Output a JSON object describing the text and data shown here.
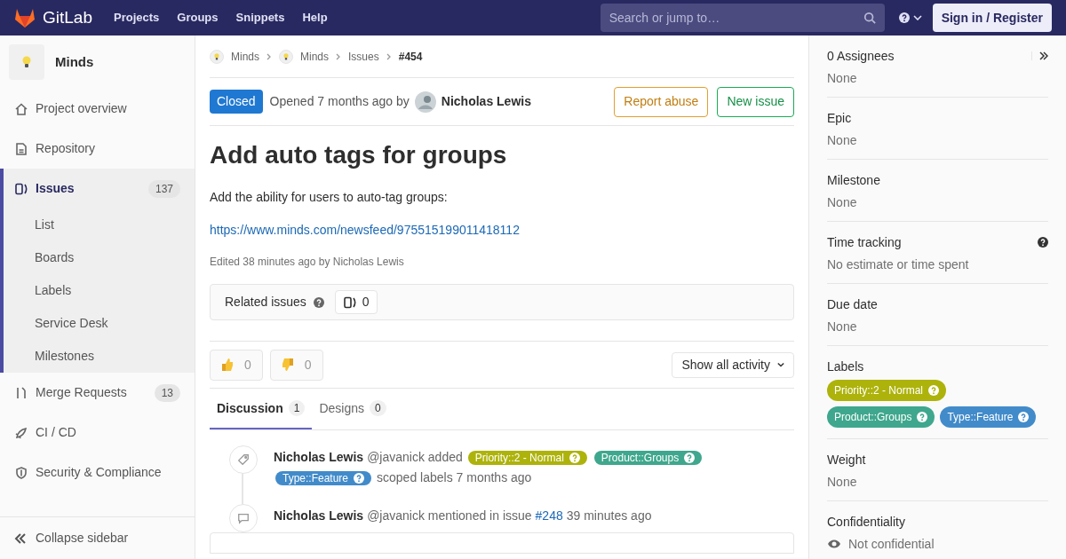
{
  "header": {
    "brand": "GitLab",
    "nav": [
      "Projects",
      "Groups",
      "Snippets",
      "Help"
    ],
    "search": {
      "placeholder": "Search or jump to…"
    },
    "sign_in": "Sign in / Register"
  },
  "sidebar": {
    "project": "Minds",
    "items": [
      {
        "label": "Project overview",
        "selected": false
      },
      {
        "label": "Repository",
        "selected": false
      },
      {
        "label": "Issues",
        "badge": "137",
        "selected": true,
        "children": [
          {
            "label": "List"
          },
          {
            "label": "Boards"
          },
          {
            "label": "Labels"
          },
          {
            "label": "Service Desk"
          },
          {
            "label": "Milestones"
          }
        ]
      },
      {
        "label": "Merge Requests",
        "badge": "13",
        "selected": false
      },
      {
        "label": "CI / CD",
        "selected": false
      },
      {
        "label": "Security & Compliance",
        "selected": false
      }
    ],
    "collapse": "Collapse sidebar"
  },
  "breadcrumbs": [
    "Minds",
    "Minds",
    "Issues",
    "#454"
  ],
  "issue": {
    "status": "Closed",
    "opened": "Opened 7 months ago by",
    "author": "Nicholas Lewis",
    "actions": [
      "Report abuse",
      "New issue"
    ],
    "title": "Add auto tags for groups",
    "description": "Add the ability for users to auto-tag groups:",
    "link": "https://www.minds.com/newsfeed/975515199011418112",
    "edited": "Edited 38 minutes ago by Nicholas Lewis",
    "related": {
      "label": "Related issues",
      "count": "0"
    },
    "reactions": [
      {
        "kind": "up",
        "count": "0"
      },
      {
        "kind": "down",
        "count": "0"
      }
    ],
    "activity_filter": "Show all activity",
    "tabs": [
      {
        "label": "Discussion",
        "count": "1",
        "selected": true
      },
      {
        "label": "Designs",
        "count": "0",
        "selected": false
      }
    ],
    "notes": [
      {
        "kind": "labels",
        "author": "Nicholas Lewis",
        "handle": "@javanick added",
        "labels": [
          {
            "text": "Priority::2 - Normal",
            "color": "#adb30b"
          },
          {
            "text": "Product::Groups",
            "color": "#3fa78d"
          },
          {
            "text": "Type::Feature",
            "color": "#428bca"
          }
        ],
        "tail": "scoped labels 7 months ago"
      },
      {
        "kind": "mention",
        "author": "Nicholas Lewis",
        "handle": "@javanick mentioned in issue",
        "ref": "#248",
        "tail": "39 minutes ago"
      }
    ]
  },
  "right_sidebar": {
    "sections": [
      {
        "title": "0 Assignees",
        "value": "None"
      },
      {
        "title": "Epic",
        "value": "None"
      },
      {
        "title": "Milestone",
        "value": "None"
      },
      {
        "kind": "help",
        "title": "Time tracking",
        "value": "No estimate or time spent"
      },
      {
        "title": "Due date",
        "value": "None"
      },
      {
        "title": "Labels",
        "labels": [
          {
            "text": "Priority::2 - Normal",
            "color": "#adb30b"
          },
          {
            "text": "Product::Groups",
            "color": "#3fa78d"
          },
          {
            "text": "Type::Feature",
            "color": "#428bca"
          }
        ]
      },
      {
        "title": "Weight",
        "value": "None"
      },
      {
        "kind": "visibility",
        "title": "Confidentiality",
        "value": "Not confidential"
      }
    ]
  }
}
